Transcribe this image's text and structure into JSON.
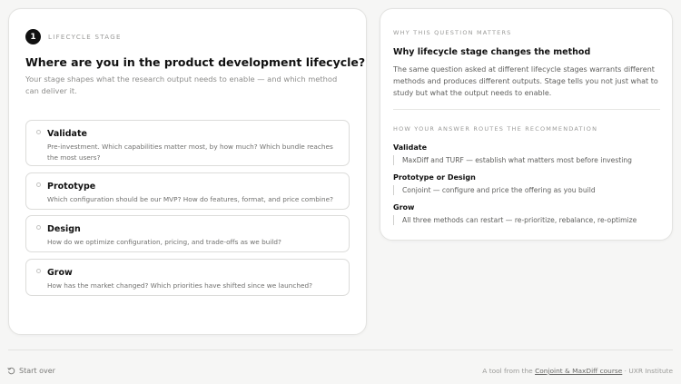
{
  "step": {
    "number": "1",
    "label": "LIFECYCLE STAGE"
  },
  "question": {
    "title": "Where are you in the product development lifecycle?",
    "subtitle": "Your stage shapes what the research output needs to enable — and which method can deliver it."
  },
  "options": [
    {
      "title": "Validate",
      "desc": "Pre-investment. Which capabilities matter most, by how much? Which bundle reaches the most users?"
    },
    {
      "title": "Prototype",
      "desc": "Which configuration should be our MVP? How do features, format, and price combine?"
    },
    {
      "title": "Design",
      "desc": "How do we optimize configuration, pricing, and trade-offs as we build?"
    },
    {
      "title": "Grow",
      "desc": "How has the market changed? Which priorities have shifted since we launched?"
    }
  ],
  "why": {
    "kicker": "WHY THIS QUESTION MATTERS",
    "heading": "Why lifecycle stage changes the method",
    "body": "The same question asked at different lifecycle stages warrants different methods and produces different outputs. Stage tells you not just what to study but what the output needs to enable."
  },
  "routes": {
    "kicker": "HOW YOUR ANSWER ROUTES THE RECOMMENDATION",
    "items": [
      {
        "title": "Validate",
        "desc": "MaxDiff and TURF — establish what matters most before investing"
      },
      {
        "title": "Prototype or Design",
        "desc": "Conjoint — configure and price the offering as you build"
      },
      {
        "title": "Grow",
        "desc": "All three methods can restart — re-prioritize, rebalance, re-optimize"
      }
    ]
  },
  "footer": {
    "start_over": "Start over",
    "icon": "restart-icon",
    "credit_prefix": "A tool from the ",
    "credit_link": "Conjoint & MaxDiff course",
    "credit_suffix": " · UXR Institute"
  }
}
